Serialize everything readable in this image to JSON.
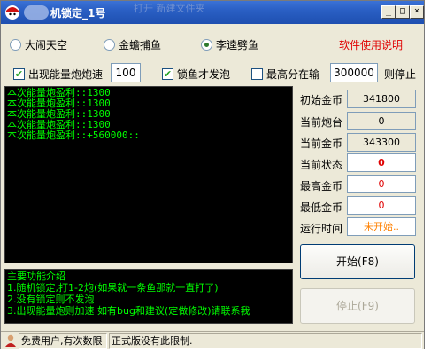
{
  "window": {
    "title": "机锁定_1号",
    "ghost_text": "打开  新建文件夹"
  },
  "titlebar_buttons": {
    "minimize": "_",
    "maximize": "□",
    "close": "×"
  },
  "modes": [
    {
      "label": "大闹天空",
      "selected": false
    },
    {
      "label": "金蟾捕鱼",
      "selected": false
    },
    {
      "label": "李逵劈鱼",
      "selected": true
    }
  ],
  "help_link": "软件使用说明",
  "options": {
    "speed_check_label": "出现能量炮炮速",
    "speed_value": "100",
    "lock_fish_label": "锁鱼才发泡",
    "max_score_label": "最高分在输",
    "max_score_value": "300000",
    "max_score_suffix": "则停止"
  },
  "console_lines": [
    "本次能量炮盈利::1300",
    "本次能量炮盈利::1300",
    "本次能量炮盈利::1300",
    "本次能量炮盈利::1300",
    "本次能量炮盈利::+560000::"
  ],
  "info": [
    {
      "label": "初始金币",
      "value": "341800"
    },
    {
      "label": "当前炮台",
      "value": "0"
    },
    {
      "label": "当前金币",
      "value": "343300"
    },
    {
      "label": "当前状态",
      "value": "0"
    },
    {
      "label": "最高金币",
      "value": "0"
    },
    {
      "label": "最低金币",
      "value": "0"
    },
    {
      "label": "运行时间",
      "value": "未开始.."
    }
  ],
  "buttons": {
    "start": "开始(F8)",
    "stop": "停止(F9)"
  },
  "intro_lines": [
    "主要功能介绍",
    "1.随机锁定,打1-2炮(如果就一条鱼那就一直打了)",
    "2.没有锁定则不发泡",
    "3.出现能量炮则加速   如有bug和建议(定做修改)请联系我"
  ],
  "status": {
    "user": "免费用户,有次数限",
    "note": "正式版没有此限制."
  },
  "colors": {
    "console_text": "#00ff00",
    "alert": "#e00000",
    "warning": "#ff8000",
    "title_bar": "#2a5fc4"
  }
}
